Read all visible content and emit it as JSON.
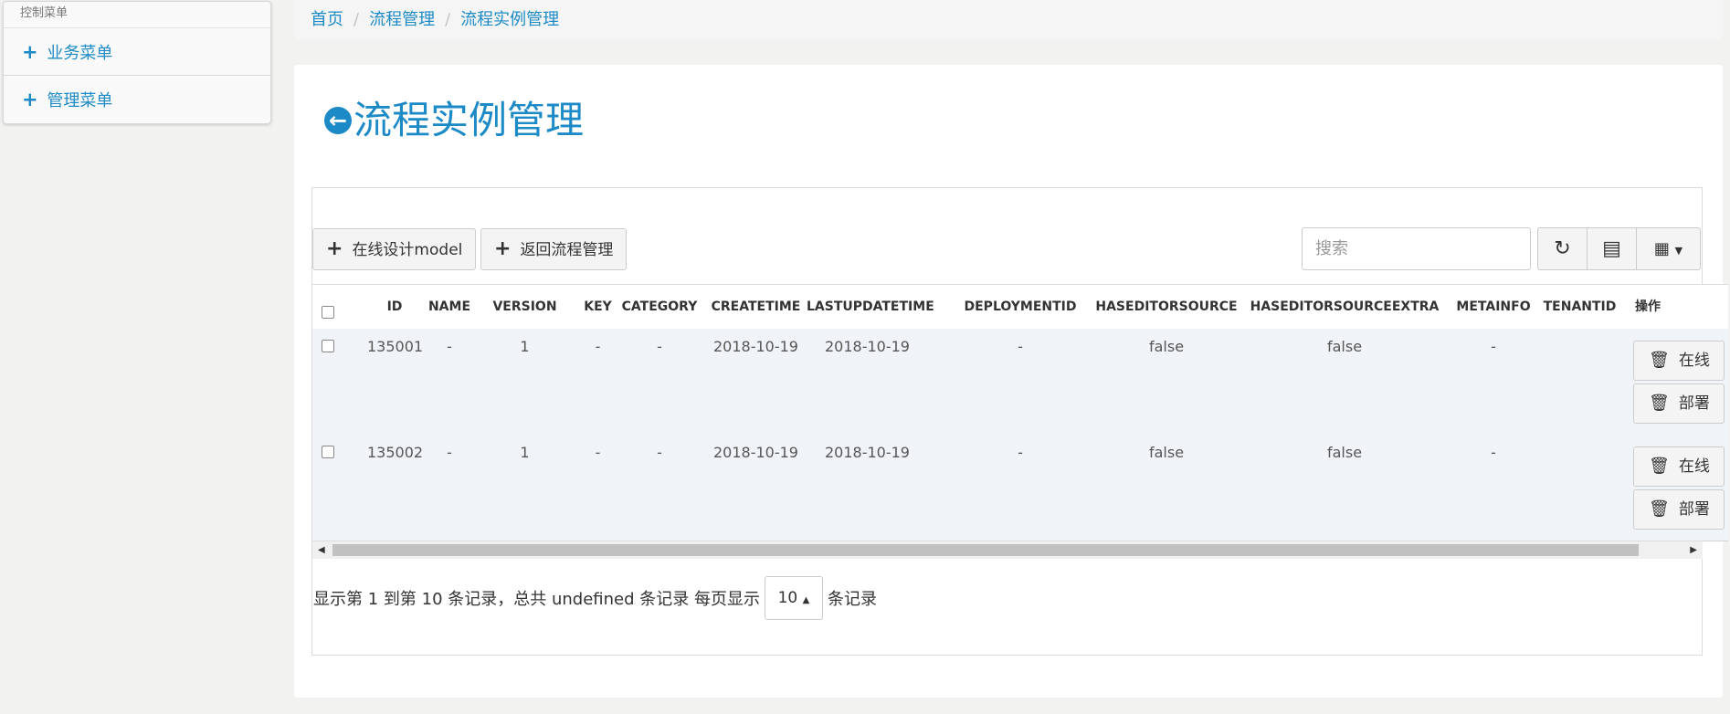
{
  "sidebar": {
    "header": "控制菜单",
    "items": [
      {
        "label": "业务菜单",
        "icon": "plus-icon"
      },
      {
        "label": "管理菜单",
        "icon": "plus-icon"
      }
    ]
  },
  "breadcrumb": [
    "首页",
    "流程管理",
    "流程实例管理"
  ],
  "page": {
    "title": "流程实例管理",
    "title_icon": "arrow-circle-left-icon"
  },
  "toolbar": {
    "design_model": "在线设计model",
    "back_to_process": "返回流程管理",
    "search_placeholder": "搜索",
    "refresh_icon": "refresh-icon",
    "toggle_icon": "list-icon",
    "columns_icon": "grid-icon"
  },
  "table": {
    "columns": [
      "ID",
      "NAME",
      "VERSION",
      "KEY",
      "CATEGORY",
      "CREATETIME",
      "LASTUPDATETIME",
      "DEPLOYMENTID",
      "HASEDITORSOURCE",
      "HASEDITORSOURCEEXTRA",
      "METAINFO",
      "TENANTID",
      "操作"
    ],
    "rows": [
      {
        "id": "135001",
        "name": "-",
        "version": "1",
        "key": "-",
        "category": "-",
        "createtime": "2018-10-19",
        "lastupdatetime": "2018-10-19",
        "deploymentid": "-",
        "haseditorsource": "false",
        "haseditorsourceextra": "false",
        "metainfo": "-",
        "tenantid": "",
        "actions": [
          "在线",
          "部署"
        ]
      },
      {
        "id": "135002",
        "name": "-",
        "version": "1",
        "key": "-",
        "category": "-",
        "createtime": "2018-10-19",
        "lastupdatetime": "2018-10-19",
        "deploymentid": "-",
        "haseditorsource": "false",
        "haseditorsourceextra": "false",
        "metainfo": "-",
        "tenantid": "",
        "actions": [
          "在线",
          "部署"
        ]
      }
    ]
  },
  "pagination": {
    "summary": "显示第 1 到第 10 条记录，总共 undefined 条记录 每页显示",
    "page_size": "10",
    "suffix": "条记录"
  },
  "colors": {
    "accent": "#1c8ac6",
    "row_bg": "#f0f4f8",
    "page_bg": "#f2f2f0"
  }
}
